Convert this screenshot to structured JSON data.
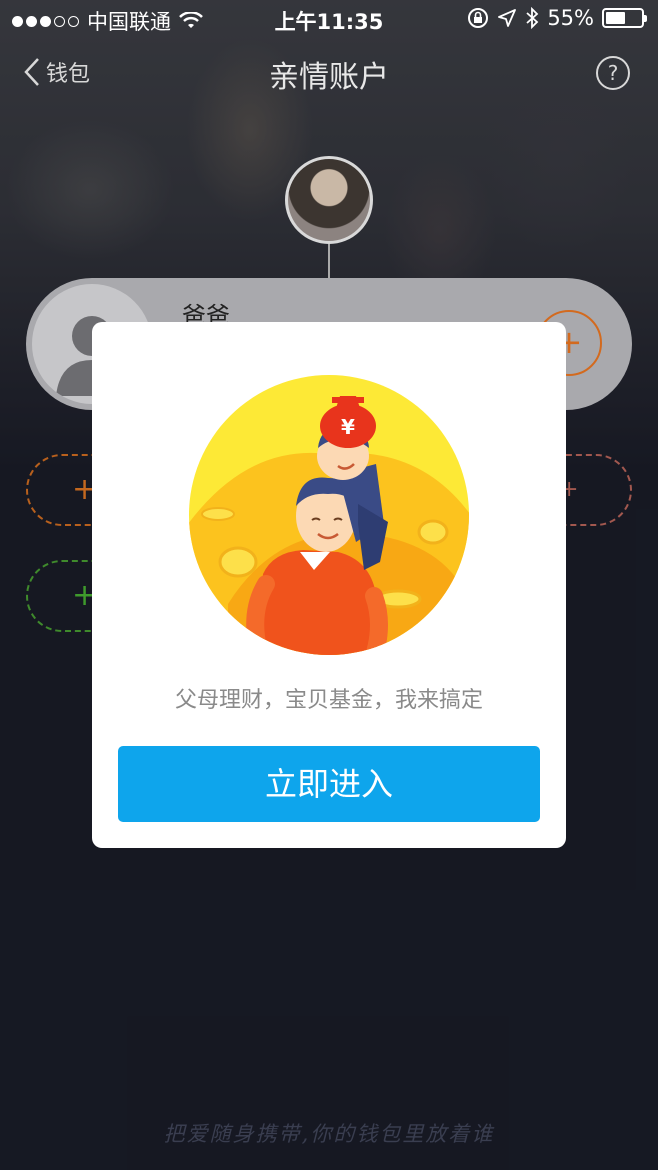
{
  "status_bar": {
    "carrier": "中国联通",
    "time": "上午11:35",
    "battery": "55%",
    "battery_level": 0.55,
    "signal_bars": 3
  },
  "nav": {
    "back_label": "钱包",
    "title": "亲情账户",
    "help_icon": "?"
  },
  "family": {
    "member_name": "爸爸",
    "add_symbol": "+"
  },
  "modal": {
    "currency_symbol": "¥",
    "promo_text": "父母理财，宝贝基金，我来搞定",
    "button_label": "立即进入"
  },
  "footer": {
    "slogan": "把爱随身携带,你的钱包里放着谁"
  },
  "colors": {
    "accent_blue": "#0ea5ec",
    "orange": "#d36a1e",
    "green": "#3f9a2c",
    "background": "#1f2230"
  }
}
